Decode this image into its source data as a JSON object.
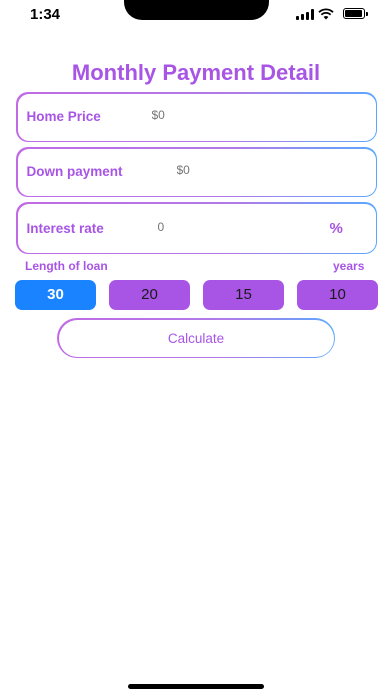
{
  "status_bar": {
    "time": "1:34"
  },
  "title": "Monthly Payment Detail",
  "fields": {
    "home_price": {
      "label": "Home Price",
      "value": "",
      "placeholder": "$0"
    },
    "down_payment": {
      "label": "Down payment",
      "value": "",
      "placeholder": "$0"
    },
    "interest_rate": {
      "label": "Interest rate",
      "value": "",
      "placeholder": "0",
      "unit": "%"
    }
  },
  "loan": {
    "label": "Length of loan",
    "unit": "years",
    "options": [
      "30",
      "20",
      "15",
      "10"
    ],
    "selected": "30"
  },
  "calculate_label": "Calculate",
  "colors": {
    "accent_purple": "#a855e6",
    "selected_blue": "#1a83ff",
    "gradient_end": "#5aa8ff"
  }
}
